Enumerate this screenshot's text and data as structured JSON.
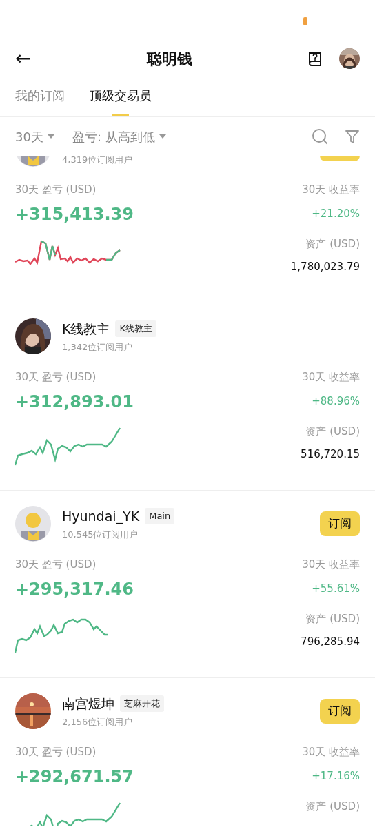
{
  "header": {
    "title": "聪明钱",
    "back": "←"
  },
  "tabs": [
    {
      "label": "我的订阅",
      "selected": false
    },
    {
      "label": "顶级交易员",
      "selected": true
    }
  ],
  "filters": [
    {
      "label": "30天"
    },
    {
      "label": "盈亏: 从高到低"
    }
  ],
  "traders": [
    {
      "avatar": {
        "kind": "icon"
      },
      "subscribers": "4,319位订阅用户",
      "subscribe_button": true,
      "pnl_label": "30天 盈亏 (USD)",
      "pnl": "+315,413.39",
      "roi_label": "30天 收益率",
      "roi": "+21.20%",
      "assets_label": "资产 (USD)",
      "assets": "1,780,023.79"
    },
    {
      "name": "K线教主",
      "tag": "K线教主",
      "subscribers": "1,342位订阅用户",
      "subscribe_button": false,
      "pnl_label": "30天 盈亏 (USD)",
      "pnl": "+312,893.01",
      "roi_label": "30天 收益率",
      "roi": "+88.96%",
      "assets_label": "资产 (USD)",
      "assets": "516,720.15"
    },
    {
      "avatar": {
        "kind": "icon"
      },
      "name": "Hyundai_YK",
      "tag": "Main",
      "subscribers": "10,545位订阅用户",
      "subscribe_button": true,
      "button_label": "订阅",
      "pnl_label": "30天 盈亏 (USD)",
      "pnl": "+295,317.46",
      "roi_label": "30天 收益率",
      "roi": "+55.61%",
      "assets_label": "资产 (USD)",
      "assets": "796,285.94"
    },
    {
      "name": "南宫煜坤",
      "tag": "芝麻开花",
      "subscribers": "2,156位订阅用户",
      "subscribe_button": true,
      "button_label": "订阅",
      "pnl_label": "30天 盈亏 (USD)",
      "pnl": "+292,671.57",
      "roi_label": "30天 收益率",
      "roi": "+17.16%",
      "assets_label": "资产 (USD)"
    }
  ]
}
